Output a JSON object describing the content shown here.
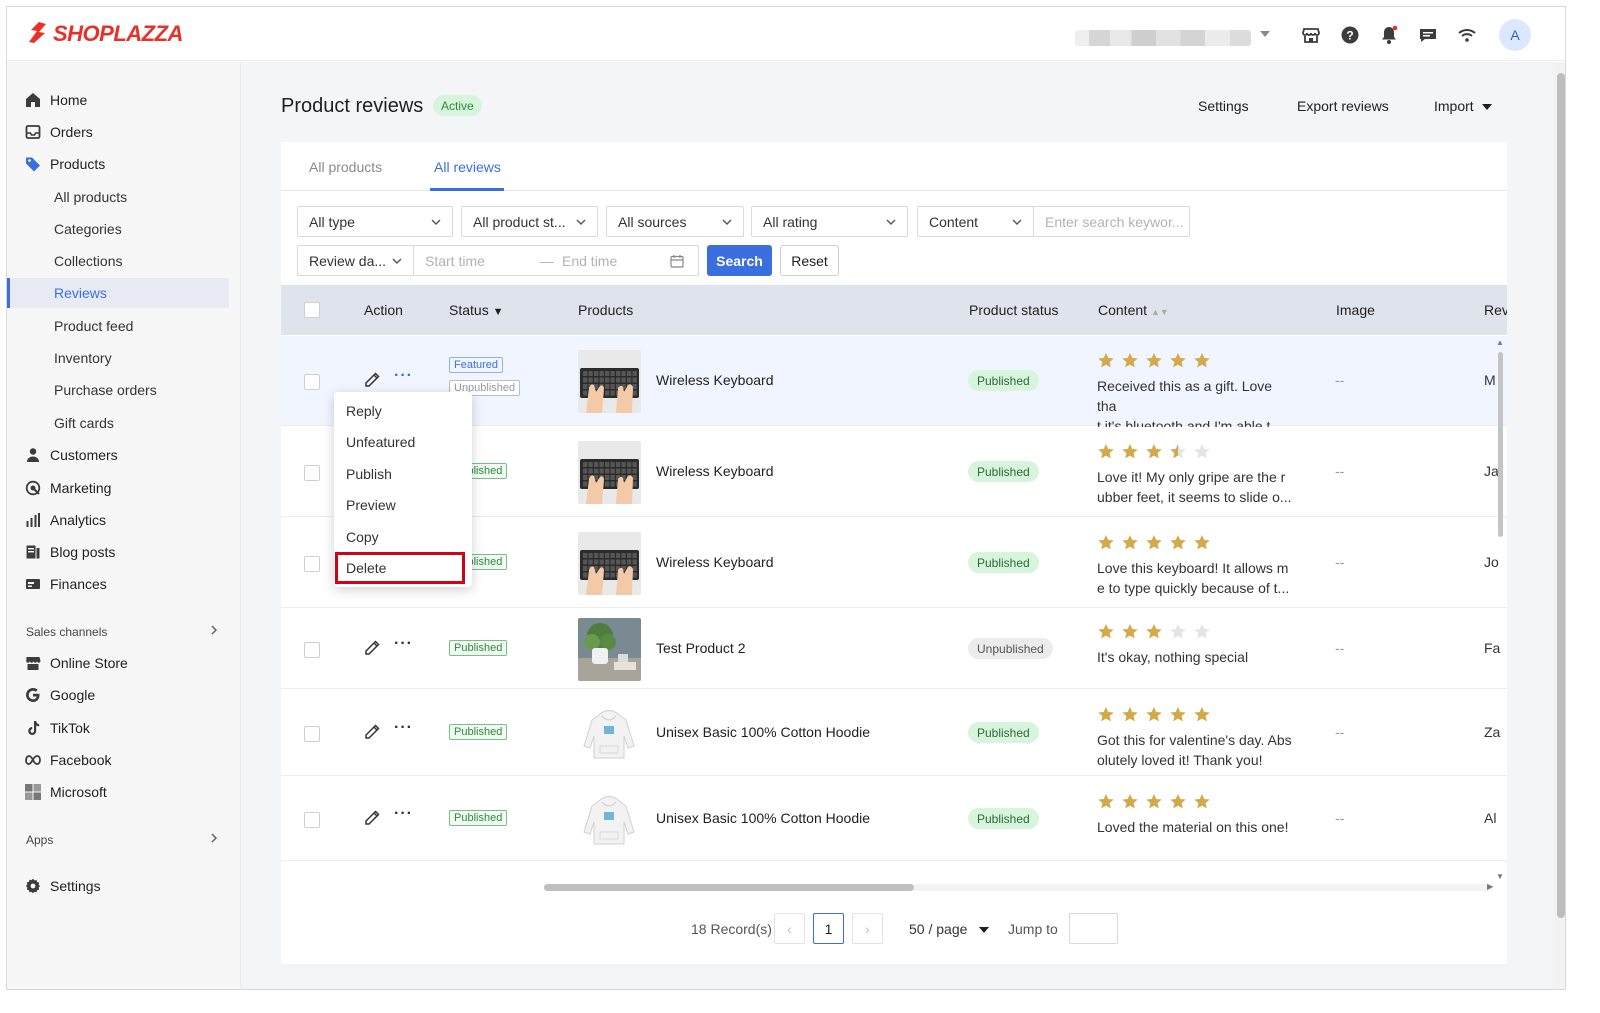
{
  "brand": {
    "name": "SHOPLAZZA",
    "color": "#e7302a"
  },
  "topbar": {
    "icons": [
      "store-icon",
      "help-icon",
      "bell-icon",
      "chat-icon",
      "wifi-icon"
    ],
    "avatar_letter": "A"
  },
  "sidebar": {
    "items": [
      {
        "label": "Home",
        "icon": "home-icon"
      },
      {
        "label": "Orders",
        "icon": "orders-icon"
      },
      {
        "label": "Products",
        "icon": "tag-icon"
      },
      {
        "label": "Customers",
        "icon": "person-icon"
      },
      {
        "label": "Marketing",
        "icon": "marketing-icon"
      },
      {
        "label": "Analytics",
        "icon": "bar-chart-icon"
      },
      {
        "label": "Blog posts",
        "icon": "blog-icon"
      },
      {
        "label": "Finances",
        "icon": "finance-icon"
      }
    ],
    "product_sub": [
      "All products",
      "Categories",
      "Collections",
      "Reviews",
      "Product feed",
      "Inventory",
      "Purchase orders",
      "Gift cards"
    ],
    "active_sub": "Reviews",
    "sales_channels_title": "Sales channels",
    "channels": [
      {
        "label": "Online Store",
        "icon": "store-icon"
      },
      {
        "label": "Google",
        "icon": "google-icon"
      },
      {
        "label": "TikTok",
        "icon": "tiktok-icon"
      },
      {
        "label": "Facebook",
        "icon": "meta-icon"
      },
      {
        "label": "Microsoft",
        "icon": "microsoft-icon"
      }
    ],
    "apps_title": "Apps",
    "settings_label": "Settings"
  },
  "header": {
    "title": "Product reviews",
    "badge": "Active",
    "settings": "Settings",
    "export": "Export reviews",
    "import": "Import"
  },
  "tabs": [
    "All products",
    "All reviews"
  ],
  "active_tab": "All reviews",
  "filters": {
    "type": "All type",
    "product_status": "All product st...",
    "sources": "All sources",
    "rating": "All rating",
    "content": "Content",
    "search_placeholder": "Enter search keywor...",
    "date_type": "Review da...",
    "start_placeholder": "Start time",
    "end_placeholder": "End time",
    "search_btn": "Search",
    "reset_btn": "Reset"
  },
  "table": {
    "columns": [
      "Action",
      "Status",
      "Products",
      "Product status",
      "Content",
      "Image",
      "Rev"
    ],
    "rows": [
      {
        "tags": [
          "Featured",
          "Unpublished"
        ],
        "product": "Wireless Keyboard",
        "thumb": "keyboard",
        "product_status": "Published",
        "rating": 5,
        "content_l1": "Received this as a gift. Love tha",
        "content_l2": "t it's bluetooth and I'm able t...",
        "image": "--",
        "reviewer": "M"
      },
      {
        "tags": [
          "Published"
        ],
        "product": "Wireless Keyboard",
        "thumb": "keyboard",
        "product_status": "Published",
        "rating": 3.5,
        "content_l1": "Love it! My only gripe are the r",
        "content_l2": "ubber feet, it seems to slide o...",
        "image": "--",
        "reviewer": "Ja"
      },
      {
        "tags": [
          "Published"
        ],
        "product": "Wireless Keyboard",
        "thumb": "keyboard",
        "product_status": "Published",
        "rating": 5,
        "content_l1": "Love this keyboard! It allows m",
        "content_l2": "e to type quickly because of t...",
        "image": "--",
        "reviewer": "Jo"
      },
      {
        "tags": [
          "Published"
        ],
        "product": "Test Product 2",
        "thumb": "plant",
        "product_status": "Unpublished",
        "rating": 3,
        "content_l1": "It's okay, nothing special",
        "content_l2": "",
        "image": "--",
        "reviewer": "Fa"
      },
      {
        "tags": [
          "Published"
        ],
        "product": "Unisex Basic 100% Cotton Hoodie",
        "thumb": "hoodie",
        "product_status": "Published",
        "rating": 5,
        "content_l1": "Got this for valentine's day. Abs",
        "content_l2": "olutely loved it! Thank you!",
        "image": "--",
        "reviewer": "Za"
      },
      {
        "tags": [
          "Published"
        ],
        "product": "Unisex Basic 100% Cotton Hoodie",
        "thumb": "hoodie",
        "product_status": "Published",
        "rating": 5,
        "content_l1": "Loved the material on this one!",
        "content_l2": "",
        "image": "--",
        "reviewer": "Al"
      }
    ]
  },
  "menu": {
    "items": [
      "Reply",
      "Unfeatured",
      "Publish",
      "Preview",
      "Copy",
      "Delete"
    ],
    "highlighted": "Delete"
  },
  "pagination": {
    "records": "18 Record(s)",
    "current_page": "1",
    "page_size": "50 / page",
    "jump_label": "Jump to"
  },
  "colors": {
    "accent": "#3b6fe0",
    "star": "#d4a94a",
    "highlight": "#d0021b"
  }
}
